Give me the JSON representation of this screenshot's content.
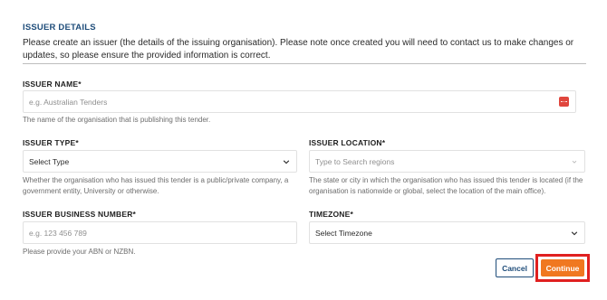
{
  "section": {
    "title": "ISSUER DETAILS",
    "intro": "Please create an issuer (the details of the issuing organisation). Please note once created you will need to contact us to make changes or updates, so please ensure the provided information is correct."
  },
  "fields": {
    "issuer_name": {
      "label": "ISSUER NAME*",
      "placeholder": "e.g. Australian Tenders",
      "help": "The name of the organisation that is publishing this tender.",
      "icon": "password-manager-icon"
    },
    "issuer_type": {
      "label": "ISSUER TYPE*",
      "value": "Select Type",
      "help": "Whether the organisation who has issued this tender is a public/private company, a government entity, University or otherwise."
    },
    "issuer_location": {
      "label": "ISSUER LOCATION*",
      "placeholder": "Type to Search regions",
      "help": "The state or city in which the organisation who has issued this tender is located (if the organisation is nationwide or global, select the location of the main office)."
    },
    "issuer_business_number": {
      "label": "ISSUER BUSINESS NUMBER*",
      "placeholder": "e.g. 123 456 789",
      "help": "Please provide your ABN or NZBN."
    },
    "timezone": {
      "label": "TIMEZONE*",
      "value": "Select Timezone"
    }
  },
  "actions": {
    "cancel_label": "Cancel",
    "continue_label": "Continue"
  },
  "colors": {
    "heading": "#1f4d7a",
    "primary": "#f07820",
    "highlight": "#e02020"
  }
}
